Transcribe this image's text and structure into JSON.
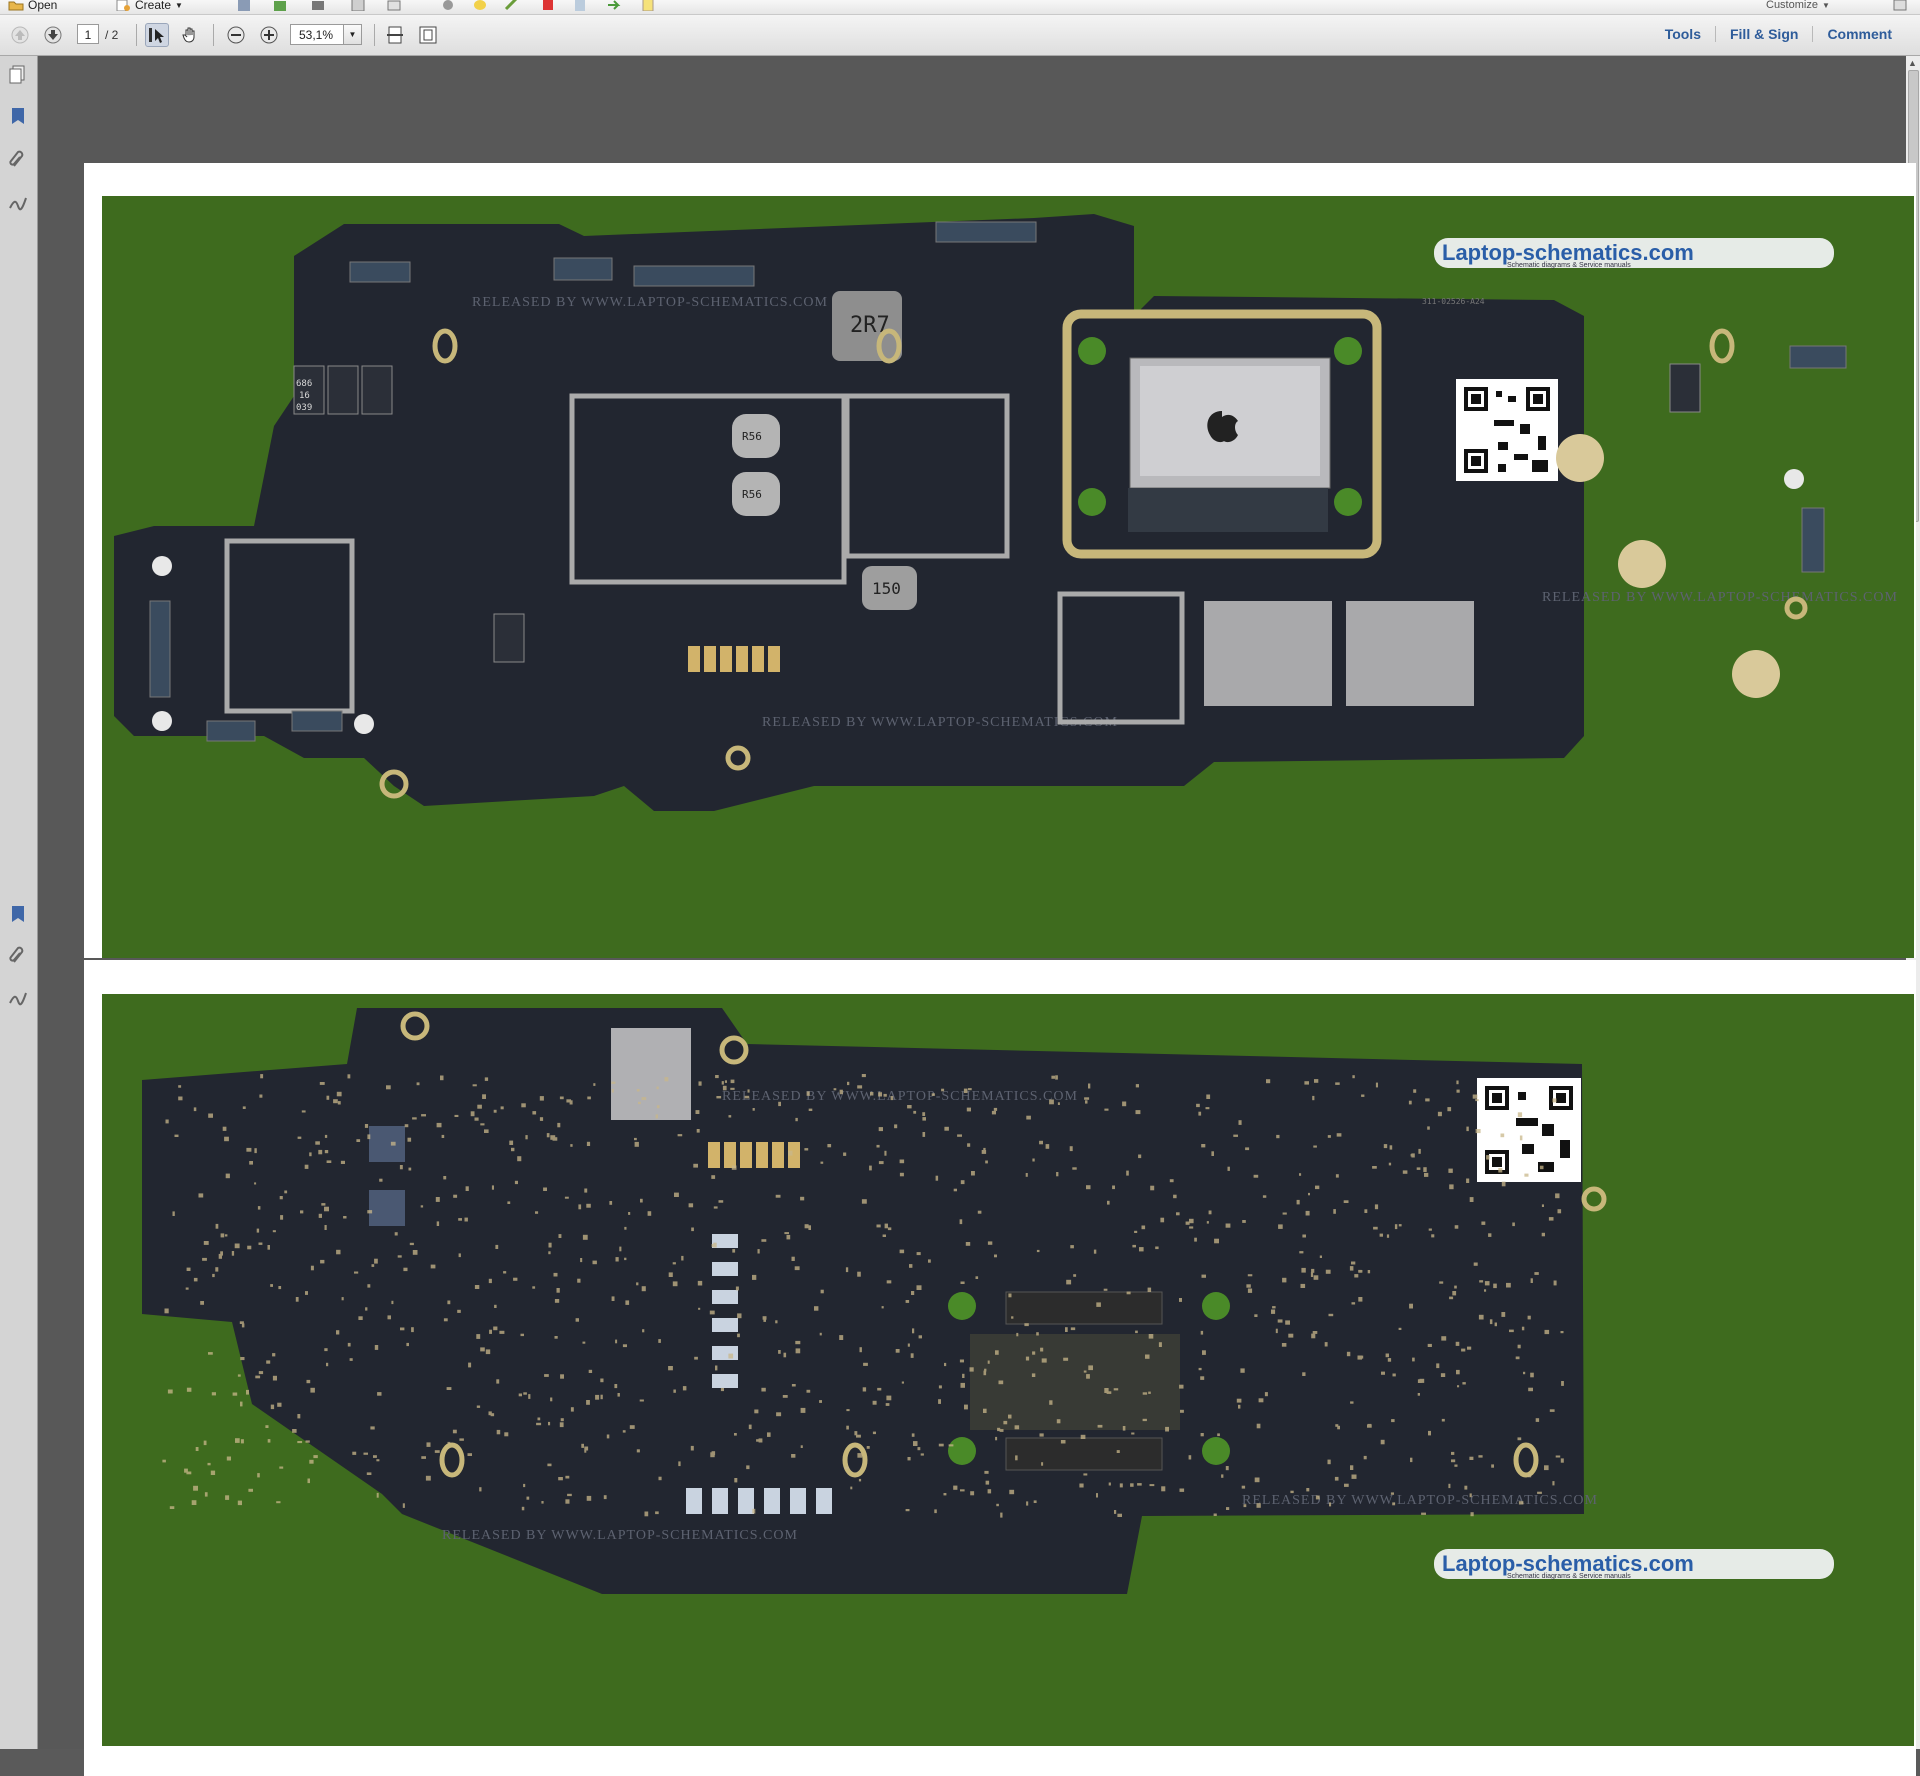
{
  "menubar": {
    "open_label": "Open",
    "create_label": "Create",
    "customize_label": "Customize"
  },
  "toolbar": {
    "current_page": "1",
    "total_pages": "/ 2",
    "zoom_value": "53,1%",
    "links": {
      "tools": "Tools",
      "fill_sign": "Fill & Sign",
      "comment": "Comment"
    }
  },
  "document": {
    "logo": {
      "title": "Laptop-schematics.com",
      "subtitle": "Schematic diagrams & Service manuals"
    },
    "watermark": "RELEASED BY WWW.LAPTOP-SCHEMATICS.COM",
    "labels": {
      "inductor_large": "2R7",
      "inductor_r56_a": "R56",
      "inductor_r56_b": "R56",
      "inductor_150": "150",
      "cap_code": "686",
      "cap_code2": "16",
      "cap_code3": "039",
      "board_code": "311-02526-A24"
    }
  },
  "colors": {
    "board_background": "#3e6b1e",
    "pcb": "#222630",
    "accent_link": "#2e5c9a",
    "gold": "#c7b77a"
  },
  "icons": [
    "open-folder-icon",
    "create-icon",
    "save-icon",
    "print-icon",
    "email-icon",
    "settings-icon",
    "comment-icon",
    "prev-page-icon",
    "next-page-icon",
    "select-tool-icon",
    "hand-tool-icon",
    "zoom-out-icon",
    "zoom-in-icon",
    "fit-width-icon",
    "fit-page-icon",
    "pages-panel-icon",
    "bookmarks-icon",
    "attachments-icon",
    "signatures-icon"
  ]
}
